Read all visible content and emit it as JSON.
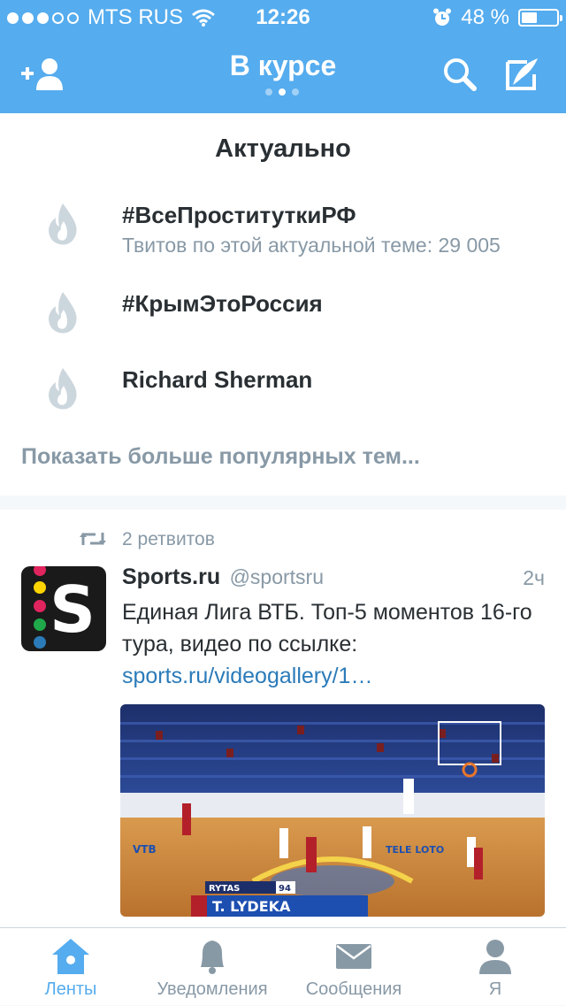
{
  "status_bar": {
    "carrier": "MTS RUS",
    "signal_dots_filled": 3,
    "signal_dots_total": 5,
    "time": "12:26",
    "battery_percent": "48 %",
    "battery_level": 0.46
  },
  "nav": {
    "title": "В курсе",
    "page_count": 3,
    "active_page": 2
  },
  "trends": {
    "title": "Актуально",
    "items": [
      {
        "name": "#ВсеПроституткиРФ",
        "sub": "Твитов по этой актуальной теме: 29 005"
      },
      {
        "name": "#КрымЭтоРоссия",
        "sub": ""
      },
      {
        "name": "Richard Sherman",
        "sub": ""
      }
    ],
    "more": "Показать больше популярных тем..."
  },
  "tweet": {
    "retweets": "2 ретвитов",
    "name": "Sports.ru",
    "handle": "@sportsru",
    "time": "2ч",
    "text": "Единая Лига ВТБ. Топ-5 моментов 16-го тура, видео по ссылке:",
    "link": "sports.ru/videogallery/1…",
    "avatar_letter": "S",
    "media": {
      "score_team": "RYTAS",
      "score_value": "94",
      "player_caption": "T. LYDEKA",
      "banner_vtb": "VTB",
      "banner_loto": "TELE LOTO"
    }
  },
  "tabs": [
    {
      "label": "Ленты",
      "icon": "home-icon",
      "active": true
    },
    {
      "label": "Уведомления",
      "icon": "bell-icon",
      "active": false
    },
    {
      "label": "Сообщения",
      "icon": "envelope-icon",
      "active": false
    },
    {
      "label": "Я",
      "icon": "person-icon",
      "active": false
    }
  ],
  "colors": {
    "accent": "#55acee",
    "text": "#292f33",
    "muted": "#8899a6",
    "link": "#2b7bb9"
  }
}
